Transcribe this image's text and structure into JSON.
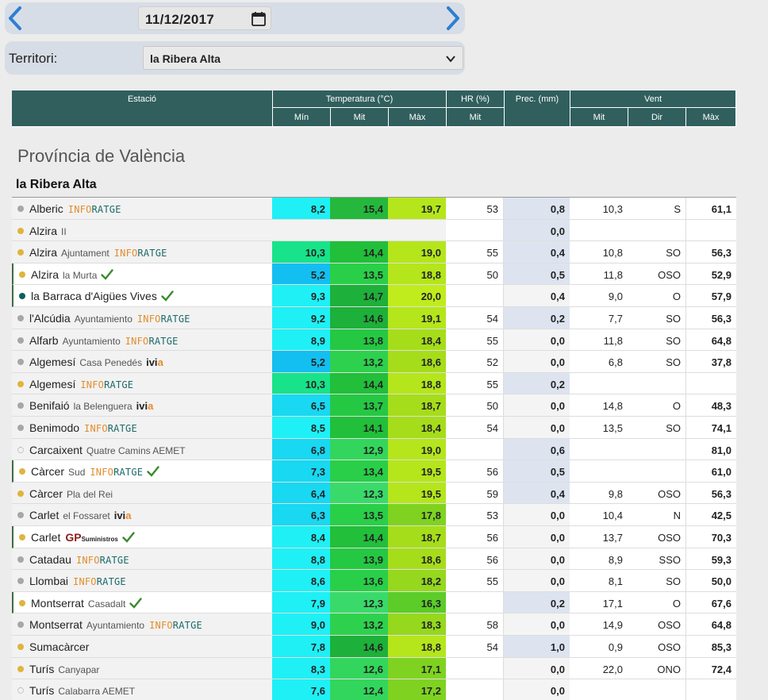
{
  "date": {
    "value": "11/12/2017",
    "prev_icon": "chevron-left-icon",
    "next_icon": "chevron-right-icon",
    "calendar_icon": "calendar-icon"
  },
  "territori": {
    "label": "Territori:",
    "selected": "la Ribera Alta"
  },
  "table_header": {
    "estacio": "Estació",
    "temperatura": "Temperatura (°C)",
    "hr": "HR (%)",
    "prec": "Prec. (mm)",
    "vent": "Vent",
    "min": "Mín",
    "mit": "Mit",
    "max": "Màx",
    "hr_mit": "Mit",
    "vent_mit": "Mit",
    "vent_dir": "Dir",
    "vent_max": "Màx"
  },
  "province": "Província de València",
  "region": "la Ribera Alta",
  "colors": {
    "header": "#305f5d",
    "prec_highlight": "#dde4f0",
    "check": "#3a8a2e"
  },
  "rows": [
    {
      "name": "Alberic",
      "sub": "",
      "tag": "ioa",
      "dot": "gray",
      "hl": false,
      "min": "8,2",
      "mit": "15,4",
      "max": "19,7",
      "hr": "53",
      "prec": "0,8",
      "pb": true,
      "vm": "10,3",
      "vd": "S",
      "vx": "61,1",
      "cmin": "#1ef0f5",
      "cmit": "#25b83c",
      "cmax": "#b4e61b"
    },
    {
      "name": "Alzira",
      "sub": "II",
      "tag": "",
      "dot": "gold",
      "hl": false,
      "min": "",
      "mit": "",
      "max": "",
      "hr": "",
      "prec": "0,0",
      "pb": true,
      "vm": "",
      "vd": "",
      "vx": "",
      "cmin": "",
      "cmit": "",
      "cmax": ""
    },
    {
      "name": "Alzira",
      "sub": "Ajuntament",
      "tag": "ioa",
      "dot": "gold",
      "hl": false,
      "min": "10,3",
      "mit": "14,4",
      "max": "19,0",
      "hr": "55",
      "prec": "0,4",
      "pb": true,
      "vm": "10,8",
      "vd": "SO",
      "vx": "56,3",
      "cmin": "#18e38a",
      "cmit": "#21bf3a",
      "cmax": "#b4e61b"
    },
    {
      "name": "Alzira",
      "sub": "la Murta",
      "tag": "check",
      "dot": "gold",
      "hl": true,
      "min": "5,2",
      "mit": "13,5",
      "max": "18,8",
      "hr": "50",
      "prec": "0,5",
      "pb": true,
      "vm": "11,8",
      "vd": "OSO",
      "vx": "52,9",
      "cmin": "#13bff0",
      "cmit": "#29cf48",
      "cmax": "#b4e61b"
    },
    {
      "name": "la Barraca d'Aigües Vives",
      "sub": "",
      "tag": "check",
      "dot": "teal",
      "hl": true,
      "min": "9,3",
      "mit": "14,7",
      "max": "20,0",
      "hr": "",
      "prec": "0,4",
      "pb": false,
      "vm": "9,0",
      "vd": "O",
      "vx": "57,9",
      "cmin": "#1ef0f5",
      "cmit": "#1db03a",
      "cmax": "#c0ec1d"
    },
    {
      "name": "l'Alcúdia",
      "sub": "Ayuntamiento",
      "tag": "ioa",
      "dot": "gray",
      "hl": false,
      "min": "9,2",
      "mit": "14,6",
      "max": "19,1",
      "hr": "54",
      "prec": "0,2",
      "pb": true,
      "vm": "7,7",
      "vd": "SO",
      "vx": "56,3",
      "cmin": "#1ef0f5",
      "cmit": "#1db03a",
      "cmax": "#b4e61b"
    },
    {
      "name": "Alfarb",
      "sub": "Ayuntamiento",
      "tag": "ioa",
      "dot": "gray",
      "hl": false,
      "min": "8,9",
      "mit": "13,8",
      "max": "18,4",
      "hr": "55",
      "prec": "0,0",
      "pb": false,
      "vm": "11,8",
      "vd": "SO",
      "vx": "64,8",
      "cmin": "#1ef0f5",
      "cmit": "#25c843",
      "cmax": "#a6dd1a"
    },
    {
      "name": "Algemesí",
      "sub": "Casa Penedés",
      "tag": "ivia",
      "dot": "gray",
      "hl": false,
      "min": "5,2",
      "mit": "13,2",
      "max": "18,6",
      "hr": "52",
      "prec": "0,0",
      "pb": false,
      "vm": "6,8",
      "vd": "SO",
      "vx": "37,8",
      "cmin": "#13bff0",
      "cmit": "#2ed14e",
      "cmax": "#a6dd1a"
    },
    {
      "name": "Algemesí",
      "sub": "",
      "tag": "ioa",
      "dot": "gold",
      "hl": false,
      "min": "10,3",
      "mit": "14,4",
      "max": "18,8",
      "hr": "55",
      "prec": "0,2",
      "pb": true,
      "vm": "",
      "vd": "",
      "vx": "",
      "cmin": "#18e38a",
      "cmit": "#21bf3a",
      "cmax": "#b4e61b"
    },
    {
      "name": "Benifaió",
      "sub": "la Belenguera",
      "tag": "ivia",
      "dot": "gray",
      "hl": false,
      "min": "6,5",
      "mit": "13,7",
      "max": "18,7",
      "hr": "50",
      "prec": "0,0",
      "pb": false,
      "vm": "14,8",
      "vd": "O",
      "vx": "48,3",
      "cmin": "#18d8f2",
      "cmit": "#25c843",
      "cmax": "#a6dd1a"
    },
    {
      "name": "Benimodo",
      "sub": "",
      "tag": "ioa",
      "dot": "gray",
      "hl": false,
      "min": "8,5",
      "mit": "14,1",
      "max": "18,4",
      "hr": "54",
      "prec": "0,0",
      "pb": false,
      "vm": "13,5",
      "vd": "SO",
      "vx": "74,1",
      "cmin": "#1ef0f5",
      "cmit": "#21bf3a",
      "cmax": "#a6dd1a"
    },
    {
      "name": "Carcaixent",
      "sub": "Quatre Camins AEMET",
      "tag": "",
      "dot": "hollow",
      "hl": false,
      "min": "6,8",
      "mit": "12,9",
      "max": "19,0",
      "hr": "",
      "prec": "0,6",
      "pb": true,
      "vm": "",
      "vd": "",
      "vx": "81,0",
      "cmin": "#18d8f2",
      "cmit": "#33d65c",
      "cmax": "#b4e61b"
    },
    {
      "name": "Càrcer",
      "sub": "Sud",
      "tag": "ioa-check",
      "dot": "gold",
      "hl": true,
      "min": "7,3",
      "mit": "13,4",
      "max": "19,5",
      "hr": "56",
      "prec": "0,5",
      "pb": true,
      "vm": "",
      "vd": "",
      "vx": "61,0",
      "cmin": "#18d8f2",
      "cmit": "#29cf48",
      "cmax": "#b4e61b"
    },
    {
      "name": "Càrcer",
      "sub": "Pla del Rei",
      "tag": "",
      "dot": "gold",
      "hl": false,
      "min": "6,4",
      "mit": "12,3",
      "max": "19,5",
      "hr": "59",
      "prec": "0,4",
      "pb": true,
      "vm": "9,8",
      "vd": "OSO",
      "vx": "56,3",
      "cmin": "#18d8f2",
      "cmit": "#3ada6a",
      "cmax": "#b4e61b"
    },
    {
      "name": "Carlet",
      "sub": "el Fossaret",
      "tag": "ivia",
      "dot": "gray",
      "hl": false,
      "min": "6,3",
      "mit": "13,5",
      "max": "17,8",
      "hr": "53",
      "prec": "0,0",
      "pb": false,
      "vm": "10,4",
      "vd": "N",
      "vx": "42,5",
      "cmin": "#18d8f2",
      "cmit": "#29cf48",
      "cmax": "#7fd320"
    },
    {
      "name": "Carlet",
      "sub": "",
      "tag": "gp",
      "dot": "gold",
      "hl": true,
      "min": "8,4",
      "mit": "14,4",
      "max": "18,7",
      "hr": "56",
      "prec": "0,0",
      "pb": false,
      "vm": "13,7",
      "vd": "OSO",
      "vx": "70,3",
      "cmin": "#1ef0f5",
      "cmit": "#21bf3a",
      "cmax": "#a6dd1a"
    },
    {
      "name": "Catadau",
      "sub": "",
      "tag": "ioa",
      "dot": "gray",
      "hl": false,
      "min": "8,8",
      "mit": "13,9",
      "max": "18,6",
      "hr": "56",
      "prec": "0,0",
      "pb": false,
      "vm": "8,9",
      "vd": "SSO",
      "vx": "59,3",
      "cmin": "#1ef0f5",
      "cmit": "#25c843",
      "cmax": "#a6dd1a"
    },
    {
      "name": "Llombai",
      "sub": "",
      "tag": "ioa",
      "dot": "gray",
      "hl": false,
      "min": "8,6",
      "mit": "13,6",
      "max": "18,2",
      "hr": "55",
      "prec": "0,0",
      "pb": false,
      "vm": "8,1",
      "vd": "SO",
      "vx": "50,0",
      "cmin": "#1ef0f5",
      "cmit": "#29cf48",
      "cmax": "#95d81e"
    },
    {
      "name": "Montserrat",
      "sub": "Casadalt",
      "tag": "check",
      "dot": "gold",
      "hl": true,
      "min": "7,9",
      "mit": "12,3",
      "max": "16,3",
      "hr": "",
      "prec": "0,2",
      "pb": true,
      "vm": "17,1",
      "vd": "O",
      "vx": "67,6",
      "cmin": "#1ef0f5",
      "cmit": "#3ada6a",
      "cmax": "#5ccc28"
    },
    {
      "name": "Montserrat",
      "sub": "Ayuntamiento",
      "tag": "ioa",
      "dot": "gray",
      "hl": false,
      "min": "9,0",
      "mit": "13,2",
      "max": "18,3",
      "hr": "58",
      "prec": "0,0",
      "pb": false,
      "vm": "14,9",
      "vd": "OSO",
      "vx": "64,8",
      "cmin": "#1ef0f5",
      "cmit": "#2ed14e",
      "cmax": "#95d81e"
    },
    {
      "name": "Sumacàrcer",
      "sub": "",
      "tag": "",
      "dot": "gold",
      "hl": false,
      "min": "7,8",
      "mit": "14,6",
      "max": "18,8",
      "hr": "54",
      "prec": "1,0",
      "pb": true,
      "vm": "0,9",
      "vd": "OSO",
      "vx": "85,3",
      "cmin": "#1ef0f5",
      "cmit": "#1db03a",
      "cmax": "#b4e61b"
    },
    {
      "name": "Turís",
      "sub": "Canyapar",
      "tag": "",
      "dot": "gold",
      "hl": false,
      "min": "8,3",
      "mit": "12,6",
      "max": "17,1",
      "hr": "",
      "prec": "0,0",
      "pb": false,
      "vm": "22,0",
      "vd": "ONO",
      "vx": "72,4",
      "cmin": "#1ef0f5",
      "cmit": "#33d65c",
      "cmax": "#7fd320"
    },
    {
      "name": "Turís",
      "sub": "Calabarra AEMET",
      "tag": "",
      "dot": "hollow",
      "hl": false,
      "min": "7,6",
      "mit": "12,4",
      "max": "17,2",
      "hr": "",
      "prec": "0,0",
      "pb": false,
      "vm": "",
      "vd": "",
      "vx": "",
      "cmin": "#1ef0f5",
      "cmit": "#33d65c",
      "cmax": "#7fd320"
    }
  ],
  "brand": {
    "ioa_part1": "INFO",
    "ioa_part2": "RATGE",
    "ivia_part1": "ivi",
    "ivia_part2": "a",
    "gp": "GP",
    "gp_small": "Suministros"
  }
}
